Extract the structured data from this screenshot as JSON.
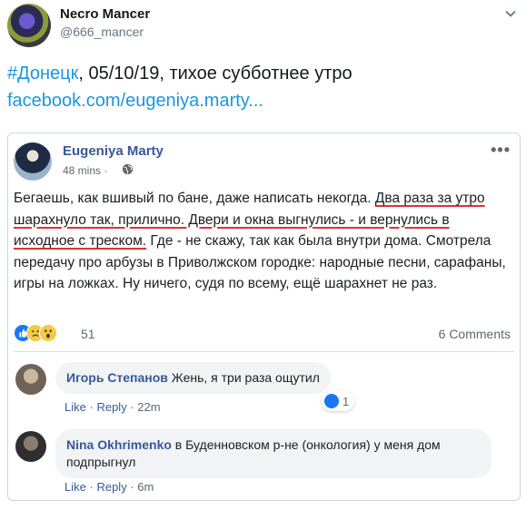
{
  "tweet": {
    "author_name": "Necro Mancer",
    "author_handle": "@666_mancer",
    "text_hashtag": "#Донецк",
    "text_rest": ", 05/10/19, тихое субботнее утро",
    "link": "facebook.com/eugeniya.marty..."
  },
  "fb_post": {
    "author": "Eugeniya Marty",
    "time": "48 mins ·",
    "body_part1": "Бегаешь, как вшивый по бане, даже написать некогда. ",
    "body_underlined": "Два раза за утро шарахнуло так, прилично. Двери и окна выгнулись - и вернулись в исходное с треском.",
    "body_part2": " Где - не скажу, так как была внутри дома. Смотрела передачу про арбузы в Приволжском городке: народные песни, сарафаны, игры на ложках. Ну ничего, судя по всему, ещё шарахнет не раз.",
    "reactions_count": "51",
    "comments_count": "6 Comments",
    "more": "•••"
  },
  "comments": [
    {
      "author": "Игорь Степанов",
      "text": " Жень, я три раза ощутил",
      "like": "Like",
      "reply": "Reply",
      "time": "22m",
      "sep": "·",
      "reaction_count": "1"
    },
    {
      "author": "Nina Okhrimenko",
      "text": " в Буденновском р-не (онкология) у меня дом подпрыгнул",
      "like": "Like",
      "reply": "Reply",
      "time": "6m",
      "sep": "·"
    }
  ],
  "colors": {
    "twitter_blue": "#1b95e0",
    "facebook_blue": "#385898",
    "underline_red": "#e0313a"
  },
  "icons": [
    "chevron-down-icon",
    "globe-icon",
    "more-options-icon",
    "like-reaction-icon",
    "sad-reaction-icon",
    "wow-reaction-icon"
  ]
}
